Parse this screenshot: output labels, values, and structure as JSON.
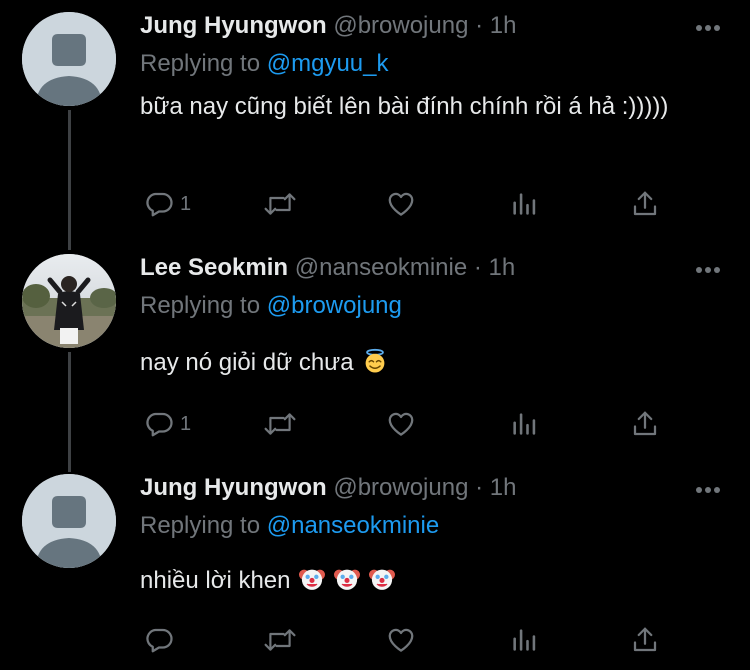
{
  "tweets": [
    {
      "name": "Jung Hyungwon",
      "handle": "@browojung",
      "dot": "·",
      "time": "1h",
      "replying_label": "Replying to",
      "replying_to": "@mgyuu_k",
      "text": "bữa nay cũng biết lên bài đính chính rồi á hả :)))))",
      "reply_count": "1"
    },
    {
      "name": "Lee Seokmin",
      "handle": "@nanseokminie",
      "dot": "·",
      "time": "1h",
      "replying_label": "Replying to",
      "replying_to": "@browojung",
      "text": "nay nó giỏi dữ chưa",
      "emojis": [
        "smiling-face-with-halo-emoji"
      ],
      "reply_count": "1"
    },
    {
      "name": "Jung Hyungwon",
      "handle": "@browojung",
      "dot": "·",
      "time": "1h",
      "replying_label": "Replying to",
      "replying_to": "@nanseokminie",
      "text": "nhiều lời khen",
      "emojis": [
        "clown-face-emoji",
        "clown-face-emoji",
        "clown-face-emoji"
      ],
      "reply_count": ""
    }
  ],
  "colors": {
    "background": "#000000",
    "text": "#e7e9ea",
    "muted": "#71767b",
    "mention": "#1d9bf0",
    "thread_line": "#3e4144"
  },
  "icons": [
    "reply-icon",
    "retweet-icon",
    "like-icon",
    "analytics-icon",
    "share-icon",
    "more-icon"
  ]
}
